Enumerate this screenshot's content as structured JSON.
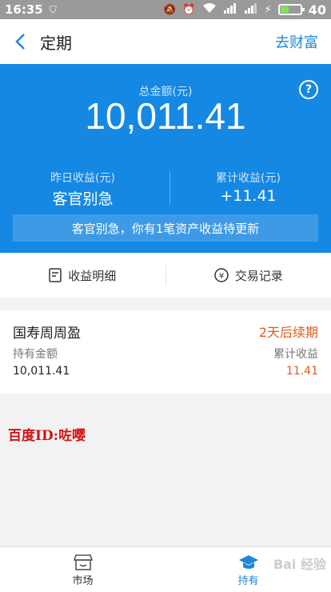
{
  "status_bar": {
    "time": "16:35",
    "battery": "40"
  },
  "nav": {
    "title": "定期",
    "action": "去财富"
  },
  "summary": {
    "total_label": "总金额(元)",
    "total_value": "10,011.41",
    "yesterday_label": "昨日收益(元)",
    "yesterday_value": "客官别急",
    "cumulative_label": "累计收益(元)",
    "cumulative_value": "+11.41",
    "notice": "客官别急，你有1笔资产收益待更新",
    "help": "?"
  },
  "tabs": [
    {
      "label": "收益明细",
      "icon": "document-icon"
    },
    {
      "label": "交易记录",
      "icon": "yen-circle-icon",
      "glyph": "¥"
    }
  ],
  "holding": {
    "name": "国寿周周盈",
    "renew_text": "2天后续期",
    "amount_label": "持有金额",
    "amount_value": "10,011.41",
    "income_label": "累计收益",
    "income_value": "11.41"
  },
  "watermark": "百度ID:咗嘤",
  "bottom_nav": [
    {
      "label": "市场",
      "icon": "store-icon"
    },
    {
      "label": "持有",
      "icon": "graduation-cap-icon"
    }
  ],
  "corner_watermark": "Bai 经验",
  "colors": {
    "primary": "#1588e4",
    "accent": "#e05a1e",
    "link": "#1e86df"
  }
}
